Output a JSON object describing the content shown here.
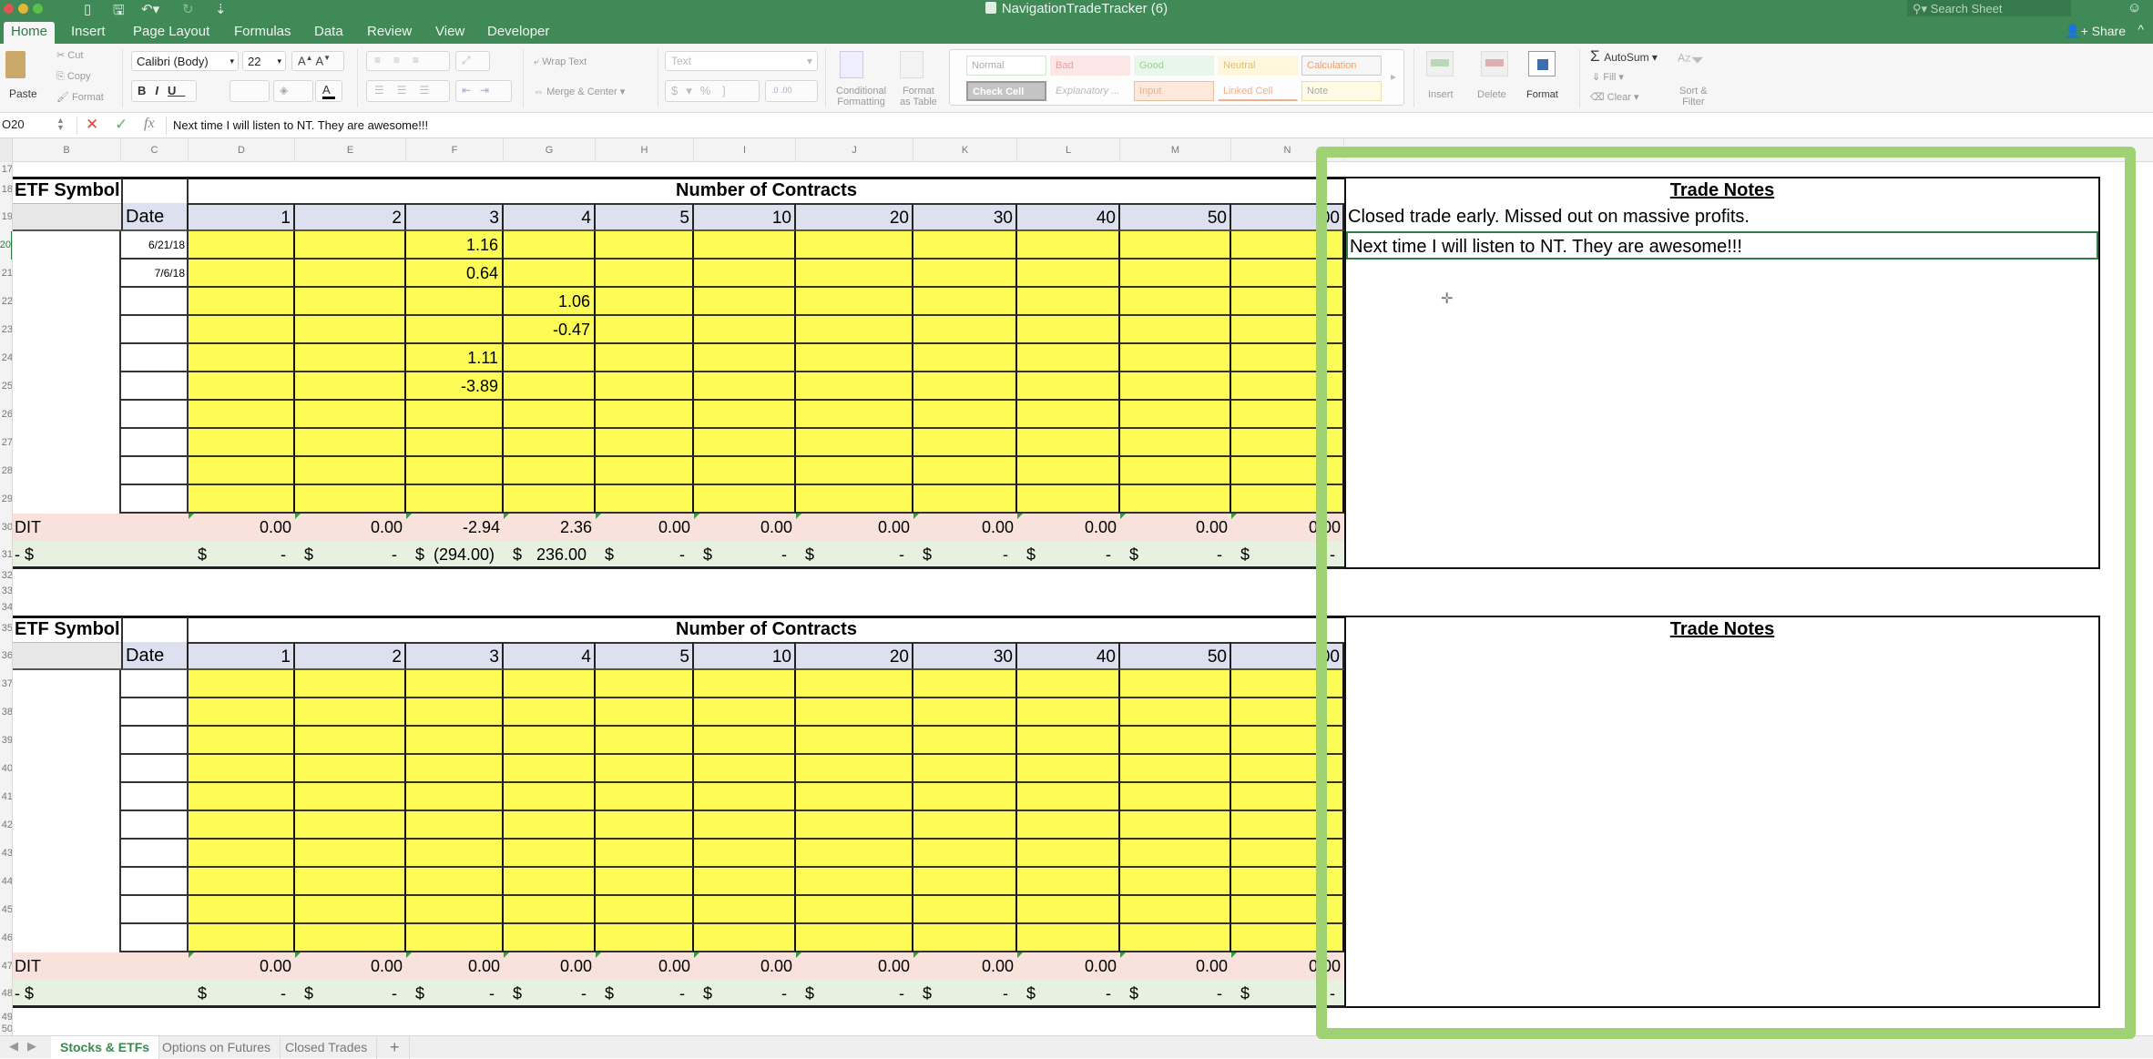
{
  "app": {
    "title": "NavigationTradeTracker (6)",
    "search_placeholder": "Search Sheet",
    "share_label": "Share",
    "ribbon_tabs": [
      "Home",
      "Insert",
      "Page Layout",
      "Formulas",
      "Data",
      "Review",
      "View",
      "Developer"
    ],
    "active_tab": "Home"
  },
  "ribbon": {
    "paste": "Paste",
    "cut": "Cut",
    "copy": "Copy",
    "format_painter": "Format",
    "font_name": "Calibri (Body)",
    "font_size": "22",
    "bold": "B",
    "italic": "I",
    "underline": "U",
    "wrap_text": "Wrap Text",
    "merge_center": "Merge & Center",
    "number_format": "Text",
    "conditional_formatting": [
      "Conditional",
      "Formatting"
    ],
    "format_as_table": [
      "Format",
      "as Table"
    ],
    "styles": [
      "Normal",
      "Bad",
      "Good",
      "Neutral",
      "Calculation",
      "Check Cell",
      "Explanatory ...",
      "Input",
      "Linked Cell",
      "Note"
    ],
    "insert": "Insert",
    "delete": "Delete",
    "format": "Format",
    "autosum": "AutoSum",
    "fill": "Fill",
    "clear": "Clear",
    "sort_filter": [
      "Sort &",
      "Filter"
    ]
  },
  "formula_bar": {
    "name_box": "O20",
    "content": "Next time I will listen to NT. They are awesome!!!"
  },
  "columns": [
    "B",
    "C",
    "D",
    "E",
    "F",
    "G",
    "H",
    "I",
    "J",
    "K",
    "L",
    "M",
    "N"
  ],
  "sections": [
    {
      "symbol_label": "ETF Symbol",
      "contracts_title": "Number of Contracts",
      "date_label": "Date",
      "contract_headers": [
        "1",
        "2",
        "3",
        "4",
        "5",
        "10",
        "20",
        "30",
        "40",
        "50",
        "00"
      ],
      "row_numbers": [
        "18",
        "19",
        "20",
        "21",
        "22",
        "23",
        "24",
        "25",
        "26",
        "27",
        "28",
        "29",
        "30",
        "31"
      ],
      "dates": [
        "6/21/18",
        "7/6/18",
        "",
        "",
        "",
        "",
        "",
        "",
        "",
        ""
      ],
      "values": [
        [
          "",
          "",
          "1.16",
          "",
          "",
          "",
          "",
          "",
          "",
          "",
          ""
        ],
        [
          "",
          "",
          "0.64",
          "",
          "",
          "",
          "",
          "",
          "",
          "",
          ""
        ],
        [
          "",
          "",
          "",
          "1.06",
          "",
          "",
          "",
          "",
          "",
          "",
          ""
        ],
        [
          "",
          "",
          "",
          "-0.47",
          "",
          "",
          "",
          "",
          "",
          "",
          ""
        ],
        [
          "",
          "",
          "1.11",
          "",
          "",
          "",
          "",
          "",
          "",
          "",
          ""
        ],
        [
          "",
          "",
          "-3.89",
          "",
          "",
          "",
          "",
          "",
          "",
          "",
          ""
        ],
        [
          "",
          "",
          "",
          "",
          "",
          "",
          "",
          "",
          "",
          "",
          ""
        ],
        [
          "",
          "",
          "",
          "",
          "",
          "",
          "",
          "",
          "",
          "",
          ""
        ],
        [
          "",
          "",
          "",
          "",
          "",
          "",
          "",
          "",
          "",
          "",
          ""
        ],
        [
          "",
          "",
          "",
          "",
          "",
          "",
          "",
          "",
          "",
          "",
          ""
        ]
      ],
      "dit_label": "DIT",
      "dit_values": [
        "0.00",
        "0.00",
        "-2.94",
        "2.36",
        "0.00",
        "0.00",
        "0.00",
        "0.00",
        "0.00",
        "0.00",
        "0.00"
      ],
      "dollar_label": "- $",
      "dollar_values": [
        "-",
        "-",
        "(294.00)",
        "236.00",
        "-",
        "-",
        "-",
        "-",
        "-",
        "-",
        "-"
      ],
      "notes_title": "Trade Notes",
      "notes": [
        "Closed trade early. Missed out on massive profits.",
        "Next time I will listen to NT. They are awesome!!!"
      ]
    },
    {
      "symbol_label": "ETF Symbol",
      "contracts_title": "Number of Contracts",
      "date_label": "Date",
      "contract_headers": [
        "1",
        "2",
        "3",
        "4",
        "5",
        "10",
        "20",
        "30",
        "40",
        "50",
        "00"
      ],
      "row_numbers": [
        "35",
        "36",
        "37",
        "38",
        "39",
        "40",
        "41",
        "42",
        "43",
        "44",
        "45",
        "46",
        "47",
        "48"
      ],
      "dates": [
        "",
        "",
        "",
        "",
        "",
        "",
        "",
        "",
        "",
        ""
      ],
      "values": [],
      "dit_label": "DIT",
      "dit_values": [
        "0.00",
        "0.00",
        "0.00",
        "0.00",
        "0.00",
        "0.00",
        "0.00",
        "0.00",
        "0.00",
        "0.00",
        "0.00"
      ],
      "dollar_label": "- $",
      "dollar_values": [
        "-",
        "-",
        "-",
        "-",
        "-",
        "-",
        "-",
        "-",
        "-",
        "-",
        "-"
      ],
      "notes_title": "Trade Notes",
      "notes": []
    }
  ],
  "extra_row_numbers": [
    "17",
    "32",
    "33",
    "34",
    "49",
    "50"
  ],
  "sheet_tabs": [
    "Stocks & ETFs",
    "Options on Futures",
    "Closed Trades"
  ],
  "active_sheet": "Stocks & ETFs",
  "colors": {
    "excel_green": "#3f8a57",
    "input_yellow": "#fdfc57",
    "header_blue": "#dde1ef",
    "dit_pink": "#f9e2dc",
    "dollar_green": "#e6f1df",
    "highlight_frame": "#9fd272"
  }
}
